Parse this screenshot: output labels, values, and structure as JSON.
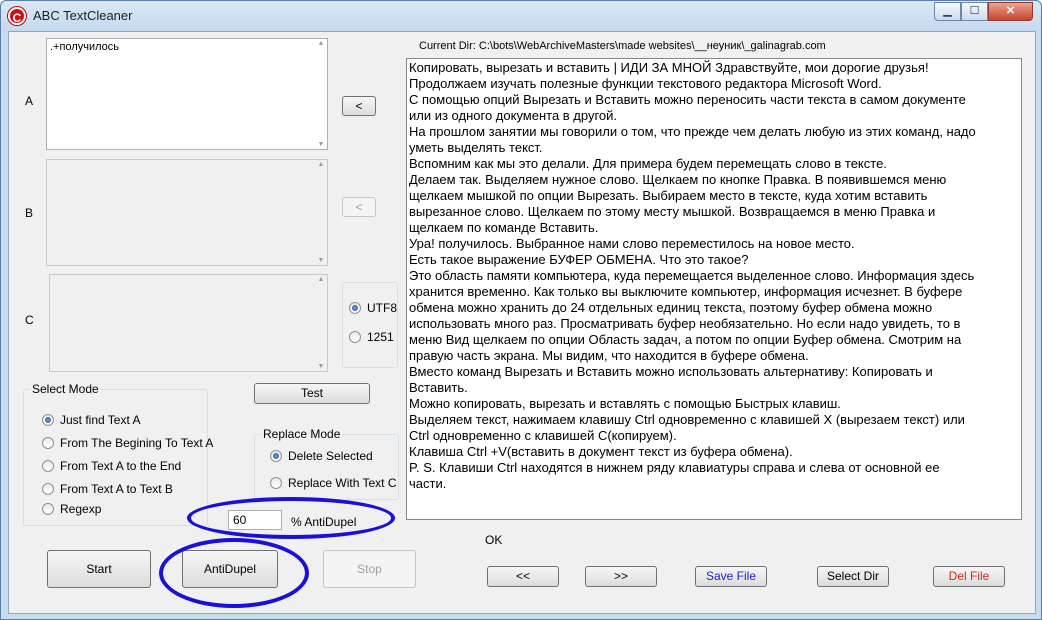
{
  "window": {
    "title": "ABC TextCleaner",
    "app_icon_glyph": "C",
    "buttons": {
      "minimize": "▁",
      "maximize": "☐",
      "close": "✕"
    }
  },
  "fields": {
    "a_label": "A",
    "b_label": "B",
    "c_label": "C",
    "a_value": ".+получилось",
    "b_value": "",
    "c_value": ""
  },
  "arrows": {
    "copy_a": "<",
    "copy_b": "<"
  },
  "encoding": {
    "options": [
      {
        "label": "UTF8",
        "checked": true
      },
      {
        "label": "1251",
        "checked": false
      }
    ]
  },
  "test_button": "Test",
  "select_mode": {
    "title": "Select Mode",
    "options": [
      {
        "label": "Just find Text A",
        "checked": true
      },
      {
        "label": "From The Begining To Text A",
        "checked": false
      },
      {
        "label": "From Text A to the End",
        "checked": false
      },
      {
        "label": "From Text A to Text B",
        "checked": false
      },
      {
        "label": "Regexp",
        "checked": false
      }
    ]
  },
  "replace_mode": {
    "title": "Replace Mode",
    "options": [
      {
        "label": "Delete Selected",
        "checked": true
      },
      {
        "label": "Replace With Text C",
        "checked": false
      }
    ]
  },
  "antidupel": {
    "value": "60",
    "label": "% AntiDupel"
  },
  "bottom_buttons": {
    "start": "Start",
    "antidupel": "AntiDupel",
    "stop": "Stop"
  },
  "current_dir": "Current Dir: C:\\bots\\WebArchiveMasters\\made websites\\__неуник\\_galinagrab.com",
  "main_text_lines": [
    "Копировать, вырезать и вставить | ИДИ ЗА МНОЙ Здравствуйте, мои дорогие друзья!",
    "Продолжаем изучать полезные функции текстового редактора Microsoft Word.",
    "С помощью опций Вырезать и Вставить можно  переносить части текста в самом документе",
    "или из одного документа в другой.",
    "На прошлом занятии мы говорили о том, что прежде чем делать любую из этих команд, надо",
    "уметь выделять текст.",
    "Вспомним как мы это делали. Для примера будем перемещать слово в тексте.",
    "Делаем так. Выделяем нужное слово. Щелкаем по кнопке Правка. В появившемся меню",
    "щелкаем мышкой по опции Вырезать. Выбираем место в тексте, куда хотим вставить",
    "вырезанное слово. Щелкаем по этому месту мышкой. Возвращаемся в меню Правка и",
    "щелкаем по команде Вставить.",
    "Ура! получилось. Выбранное нами слово переместилось на новое место.",
    "Есть такое выражение БУФЕР ОБМЕНА. Что это такое?",
    "Это область памяти компьютера, куда перемещается выделенное слово. Информация здесь",
    "хранится временно. Как только вы выключите компьютер, информация исчезнет. В буфере",
    "обмена можно хранить до 24 отдельных единиц текста, поэтому буфер обмена можно",
    "использовать много раз. Просматривать буфер необязательно. Но если надо увидеть, то в",
    "меню Вид щелкаем по опции Область задач, а потом по опции Буфер обмена. Смотрим на",
    "правую часть экрана. Мы видим, что находится в буфере обмена.",
    "Вместо команд Вырезать и Вставить можно использовать альтернативу: Копировать и",
    "Вставить.",
    "Можно  копировать, вырезать и вставлять с помощью Быстрых клавиш.",
    "Выделяем текст, нажимаем клавишу Ctrl одновременно с клавишей X (вырезаем текст) или",
    "Ctrl одновременно с клавишей С(копируем).",
    "Клавиша Ctrl +V(вставить в документ текст из буфера обмена).",
    "P. S. Клавиши Ctrl  находятся в нижнем ряду клавиатуры  справа и слева от основной ее",
    "части."
  ],
  "status": "OK",
  "nav_buttons": {
    "prev": "<<",
    "next": ">>",
    "save_file": "Save File",
    "select_dir": "Select Dir",
    "del_file": "Del File"
  },
  "colors": {
    "save_file": "#1d1fd6",
    "del_file": "#d42a14",
    "annotation": "#1a10d8"
  },
  "icons": {
    "scroll_up": "▲",
    "scroll_down": "▼"
  }
}
